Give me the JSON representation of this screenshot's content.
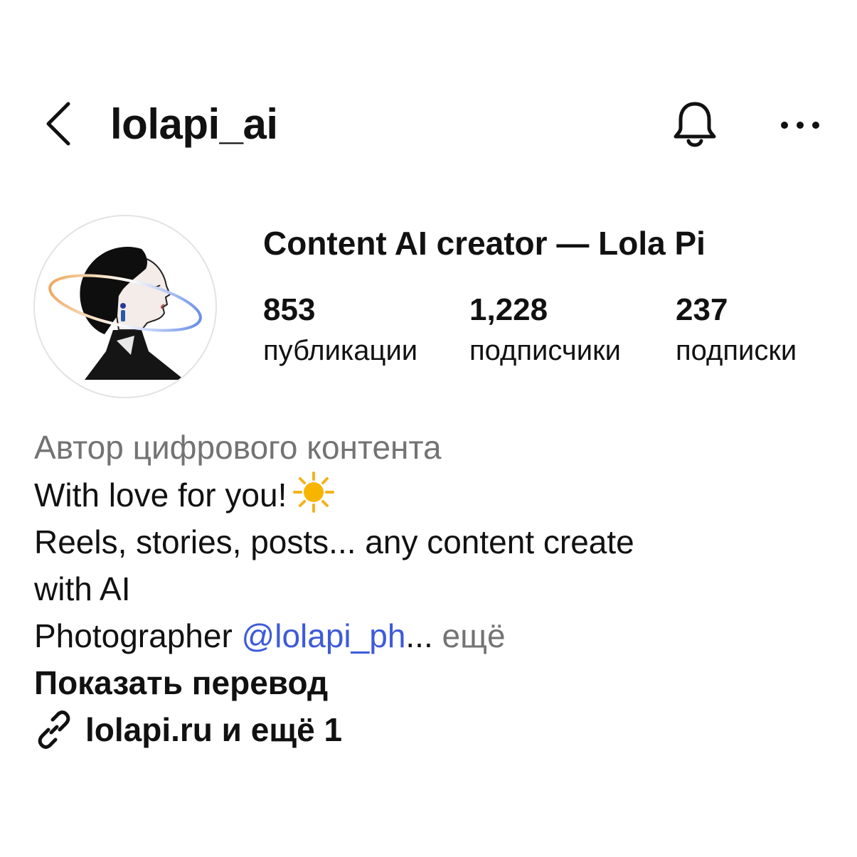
{
  "header": {
    "username": "lolapi_ai"
  },
  "profile": {
    "display_name": "Content AI creator — Lola Pi",
    "stats": {
      "posts": {
        "value": "853",
        "label": "публикации"
      },
      "followers": {
        "value": "1,228",
        "label": "подписчики"
      },
      "following": {
        "value": "237",
        "label": "подписки"
      }
    }
  },
  "bio": {
    "category": "Автор цифрового контента",
    "line1": "With love for you!",
    "line2": "Reels, stories, posts... any content  create",
    "line3": "with AI",
    "line4_prefix": "Photographer ",
    "mention": "@lolapi_ph",
    "ellipsis": "...",
    "more": " ещё",
    "translate": "Показать перевод",
    "link_text": "lolapi.ru и ещё 1"
  },
  "icons": {
    "back": "chevron-left-icon",
    "bell": "bell-icon",
    "more": "more-horizontal-icon",
    "sun": "sun-emoji-icon",
    "link": "link-icon"
  },
  "colors": {
    "text": "#111111",
    "muted": "#737373",
    "mention": "#3d5ad9",
    "background": "#ffffff"
  }
}
